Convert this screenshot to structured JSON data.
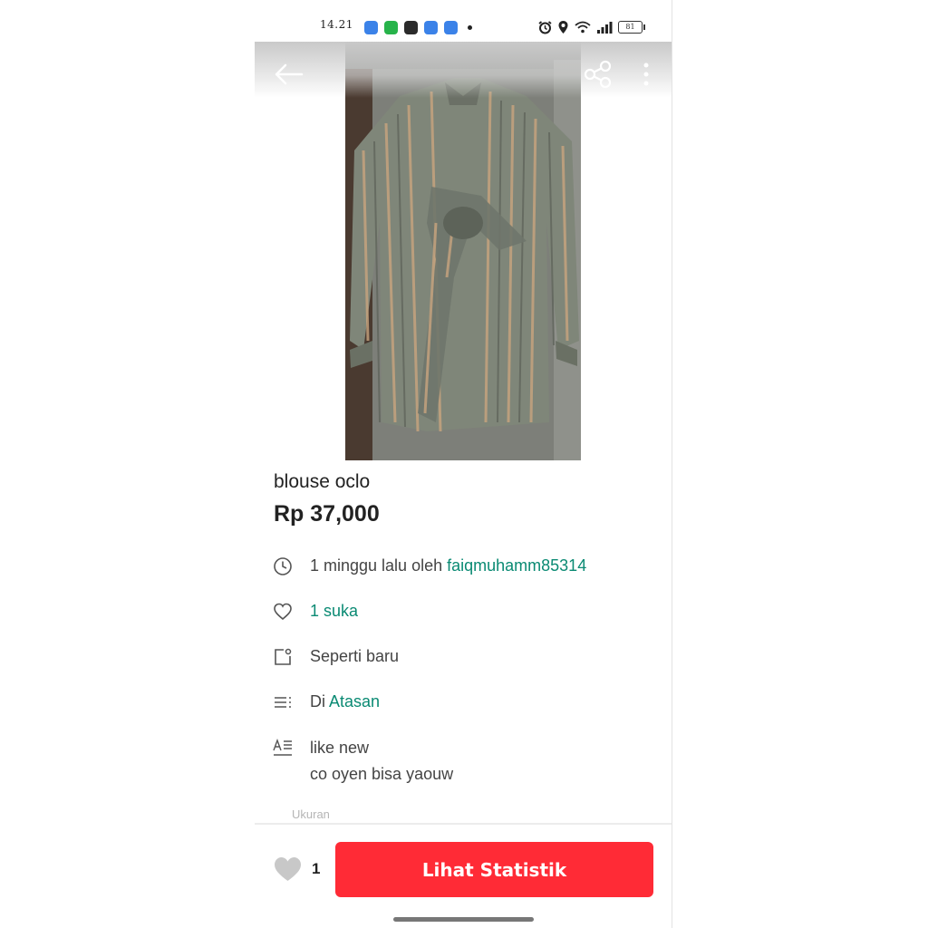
{
  "status_bar": {
    "time": "14.21",
    "battery": "81",
    "app_icons": [
      "blue-app-icon",
      "green-app-icon",
      "shop-icon",
      "blue-app-icon",
      "blue-app-icon"
    ],
    "status_icons": [
      "alarm-icon",
      "location-icon",
      "wifi-icon",
      "signal-icon",
      "battery-icon"
    ]
  },
  "toolbar": {
    "back_icon": "arrow-left-icon",
    "share_icon": "share-icon",
    "more_icon": "more-vertical-icon"
  },
  "listing": {
    "title": "blouse oclo",
    "price": "Rp 37,000",
    "posted_time": "1 minggu lalu oleh ",
    "seller": "faiqmuhamm85314",
    "likes_text": "1 suka",
    "condition": "Seperti baru",
    "category_prefix": "Di ",
    "category": "Atasan",
    "description_lines": [
      "like new",
      "co oyen bisa yaouw"
    ],
    "size_label": "Ukuran"
  },
  "bottom_bar": {
    "like_count": "1",
    "stats_button": "Lihat Statistik"
  },
  "colors": {
    "accent_green": "#0a8a73",
    "cta_red": "#ff2b36"
  }
}
